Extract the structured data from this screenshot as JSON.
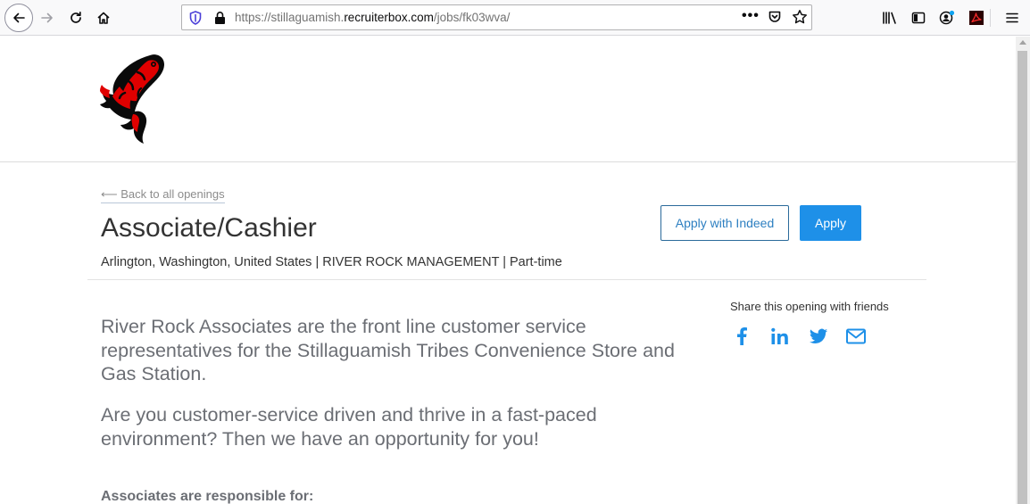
{
  "browser": {
    "url_prefix": "https://stillaguamish.",
    "url_domain": "recruiterbox.com",
    "url_path": "/jobs/fk03wva/",
    "more_label": "•••"
  },
  "job": {
    "back_label": "⟵ Back to all openings",
    "title": "Associate/Cashier",
    "meta": "Arlington, Washington, United States | RIVER ROCK MANAGEMENT | Part-time",
    "apply_indeed_label": "Apply with Indeed",
    "apply_label": "Apply"
  },
  "share": {
    "label": "Share this opening with friends",
    "icons": [
      "facebook-icon",
      "linkedin-icon",
      "twitter-icon",
      "email-icon"
    ]
  },
  "description": {
    "p1": "River Rock Associates are the front line customer service representatives for the Stillaguamish Tribes Convenience Store and Gas Station.",
    "p2": "Are you customer-service driven and thrive in a fast-paced environment? Then we have an opportunity for you!",
    "subhead": "Associates are responsible for:"
  },
  "colors": {
    "accent": "#1e90e8",
    "link": "#2d7fc1",
    "text_muted": "#6b6e74",
    "logo_red": "#e00000"
  }
}
